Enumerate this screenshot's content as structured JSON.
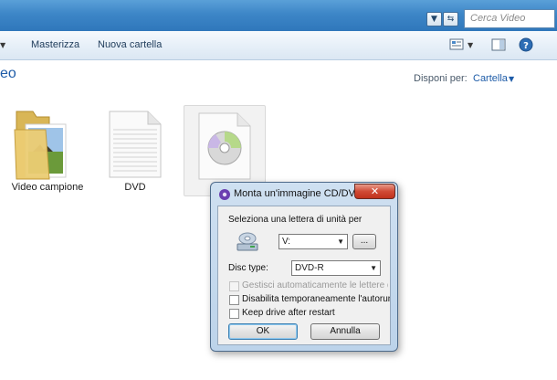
{
  "window": {
    "search_placeholder": "Cerca Video"
  },
  "toolbar": {
    "burn_label": "Masterizza",
    "new_folder_label": "Nuova cartella"
  },
  "content": {
    "title_fragment": "eo",
    "arrange_label": "Disponi per:",
    "arrange_value": "Cartella"
  },
  "files": [
    {
      "name": "Video campione",
      "icon": "folder-icon"
    },
    {
      "name": "DVD",
      "icon": "text-file-icon"
    },
    {
      "name": "",
      "icon": "disc-image-icon"
    }
  ],
  "dialog": {
    "title": "Monta un'immagine CD/DVD",
    "close_label": "✕",
    "drive_label": "Seleziona una lettera di unità per",
    "drive_value": "V:",
    "browse_label": "...",
    "disc_type_label": "Disc type:",
    "disc_type_value": "DVD-R",
    "auto_manage_label": "Gestisci automaticamente le lettere delle",
    "disable_autorun_label": "Disabilita temporaneamente l'autorun",
    "keep_drive_label": "Keep drive after restart",
    "ok_label": "OK",
    "cancel_label": "Annulla"
  },
  "colors": {
    "titlebar": "#3d86c7",
    "link_blue": "#1e5ca8",
    "close_red": "#c0321c"
  }
}
